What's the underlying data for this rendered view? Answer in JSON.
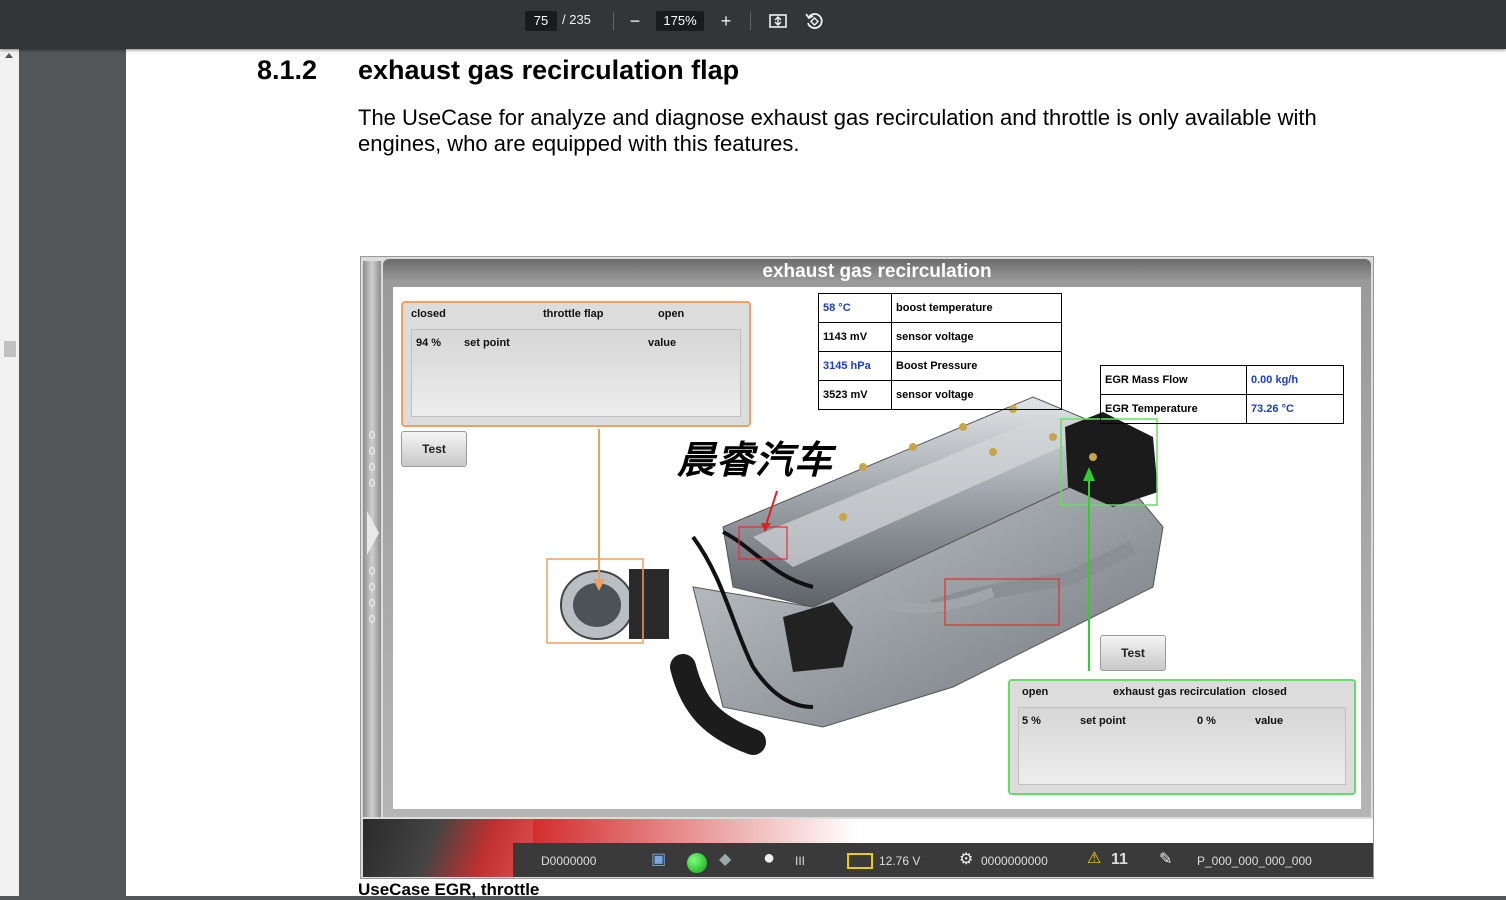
{
  "viewer": {
    "page_current": "75",
    "page_total": "/ 235",
    "zoom": "175%"
  },
  "document": {
    "section_number": "8.1.2",
    "section_title": "exhaust gas recirculation flap",
    "paragraph": "The UseCase for analyze and diagnose exhaust gas recirculation and throttle is only available with engines, who are equipped with this features.",
    "caption": "UseCase EGR, throttle"
  },
  "diagnostic": {
    "title": "exhaust gas recirculation",
    "sensor_table": [
      {
        "value": "58 °C",
        "label": "boost temperature",
        "value_blue": true
      },
      {
        "value": "1143 mV",
        "label": "sensor voltage",
        "value_blue": false
      },
      {
        "value": "3145 hPa",
        "label": "Boost Pressure",
        "value_blue": true
      },
      {
        "value": "3523 mV",
        "label": "sensor voltage",
        "value_blue": false
      }
    ],
    "egr_table": [
      {
        "label": "EGR Mass Flow",
        "value": "0.00 kg/h"
      },
      {
        "label": "EGR Temperature",
        "value": "73.26 °C"
      }
    ],
    "throttle": {
      "closed": "closed",
      "title": "throttle flap",
      "open": "open",
      "setpoint_value": "94 %",
      "setpoint_label": "set point",
      "value_label": "value"
    },
    "egr_flap": {
      "open": "open",
      "title": "exhaust gas recirculation",
      "closed": "closed",
      "setpoint_value": "5 %",
      "setpoint_label": "set point",
      "actual_value": "0 %",
      "value_label": "value"
    },
    "test_button_label": "Test",
    "watermark": "晨睿汽车",
    "status_bar": {
      "vin": "D0000000",
      "module_count": "III",
      "battery_voltage": "12.76 V",
      "odometer": "0000000000",
      "warnings": "11",
      "part_number": "P_000_000_000_000"
    },
    "colors": {
      "throttle_frame": "#f0a060",
      "egr_frame": "#66dd66",
      "value_blue": "#1a3ec8",
      "alarm_red": "#d02020"
    }
  }
}
